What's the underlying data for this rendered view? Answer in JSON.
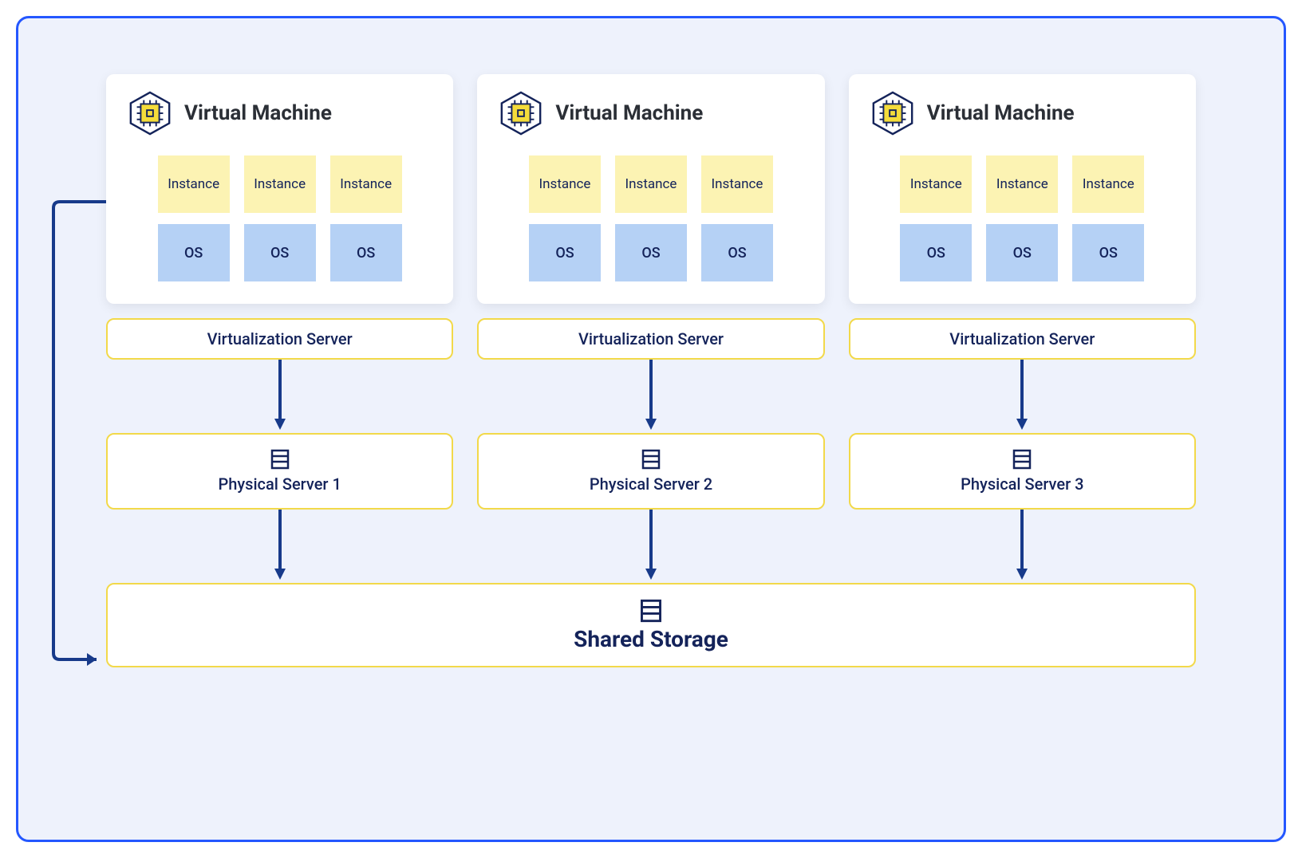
{
  "vm_title": "Virtual Machine",
  "instance_label": "Instance",
  "os_label": "OS",
  "virtualization_label": "Virtualization Server",
  "physical_server_prefix": "Physical Server",
  "columns": [
    {
      "physical": "Physical Server 1"
    },
    {
      "physical": "Physical Server 2"
    },
    {
      "physical": "Physical Server 3"
    }
  ],
  "shared_storage_label": "Shared Storage",
  "colors": {
    "frame_border": "#2457ff",
    "frame_bg": "#eef2fc",
    "instance_bg": "#fcf3b3",
    "os_bg": "#b5d1f5",
    "box_border": "#f2d94a",
    "text_navy": "#14235a",
    "arrow": "#173a8a"
  }
}
